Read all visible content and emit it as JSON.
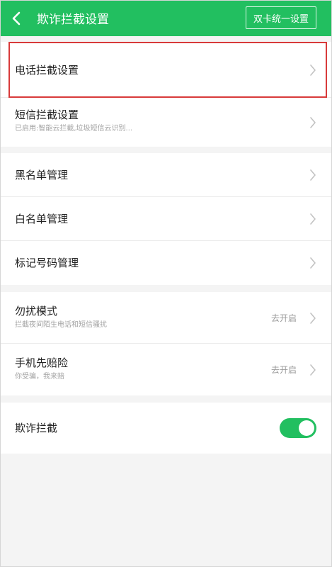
{
  "header": {
    "title": "欺诈拦截设置",
    "dual_sim_button": "双卡统一设置",
    "back_icon": "chevron-left-icon",
    "bg_color": "#22bf60"
  },
  "groups": [
    {
      "rows": [
        {
          "label": "电话拦截设置",
          "sub": "",
          "highlighted": true
        },
        {
          "label": "短信拦截设置",
          "sub": "已启用:智能云拦截,垃圾短信云识别..."
        }
      ]
    },
    {
      "rows": [
        {
          "label": "黑名单管理"
        },
        {
          "label": "白名单管理"
        },
        {
          "label": "标记号码管理"
        }
      ]
    },
    {
      "rows": [
        {
          "label": "勿扰模式",
          "sub": "拦截夜间陌生电话和短信骚扰",
          "status": "去开启"
        },
        {
          "label": "手机先赔险",
          "sub": "你受骗，我来赔",
          "status": "去开启"
        }
      ]
    },
    {
      "rows": [
        {
          "label": "欺诈拦截",
          "toggle_on": true
        }
      ]
    }
  ],
  "colors": {
    "accent": "#22bf60",
    "highlight_box": "#d83a3a"
  }
}
